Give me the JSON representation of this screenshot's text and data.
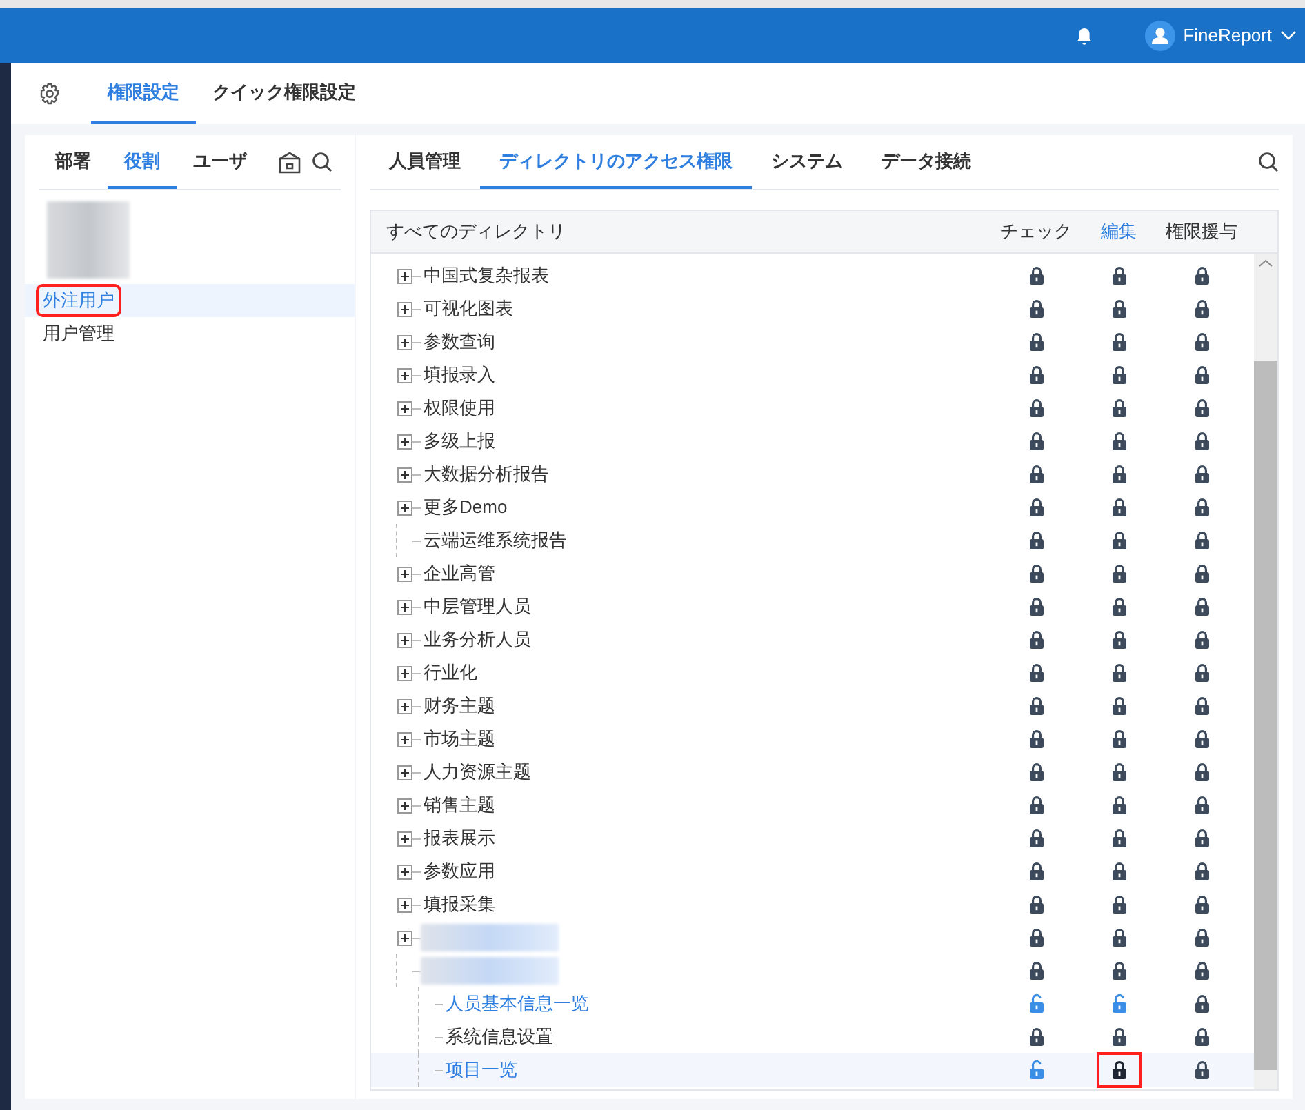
{
  "header": {
    "user": "FineReport"
  },
  "top_tabs": [
    {
      "label": "権限設定",
      "selected": true
    },
    {
      "label": "クイック権限設定",
      "selected": false
    }
  ],
  "left_tabs": [
    {
      "label": "部署",
      "selected": false
    },
    {
      "label": "役割",
      "selected": true
    },
    {
      "label": "ユーザ",
      "selected": false
    }
  ],
  "roles": [
    {
      "kind": "redacted"
    },
    {
      "kind": "item",
      "label": "外注用户",
      "selected": true,
      "highlighted": true
    },
    {
      "kind": "item",
      "label": "用户管理",
      "selected": false,
      "highlighted": false
    }
  ],
  "right_tabs": [
    {
      "label": "人員管理",
      "selected": false
    },
    {
      "label": "ディレクトリのアクセス権限",
      "selected": true
    },
    {
      "label": "システム",
      "selected": false
    },
    {
      "label": "データ接続",
      "selected": false
    }
  ],
  "table": {
    "columns": [
      {
        "label": "すべてのディレクトリ",
        "selected": false
      },
      {
        "label": "チェック",
        "selected": false
      },
      {
        "label": "編集",
        "selected": true
      },
      {
        "label": "権限援与",
        "selected": false
      }
    ],
    "rows": [
      {
        "kind": "item",
        "label": "中国式复杂报表",
        "expandable": true,
        "check_open": false,
        "edit_open": false,
        "grant_open": false
      },
      {
        "kind": "item",
        "label": "可视化图表",
        "expandable": true,
        "check_open": false,
        "edit_open": false,
        "grant_open": false
      },
      {
        "kind": "item",
        "label": "参数查询",
        "expandable": true,
        "check_open": false,
        "edit_open": false,
        "grant_open": false
      },
      {
        "kind": "item",
        "label": "填报录入",
        "expandable": true,
        "check_open": false,
        "edit_open": false,
        "grant_open": false
      },
      {
        "kind": "item",
        "label": "权限使用",
        "expandable": true,
        "check_open": false,
        "edit_open": false,
        "grant_open": false
      },
      {
        "kind": "item",
        "label": "多级上报",
        "expandable": true,
        "check_open": false,
        "edit_open": false,
        "grant_open": false
      },
      {
        "kind": "item",
        "label": "大数据分析报告",
        "expandable": true,
        "check_open": false,
        "edit_open": false,
        "grant_open": false
      },
      {
        "kind": "item",
        "label": "更多Demo",
        "expandable": true,
        "check_open": false,
        "edit_open": false,
        "grant_open": false
      },
      {
        "kind": "item",
        "label": "云端运维系统报告",
        "expandable": false,
        "check_open": false,
        "edit_open": false,
        "grant_open": false
      },
      {
        "kind": "item",
        "label": "企业高管",
        "expandable": true,
        "check_open": false,
        "edit_open": false,
        "grant_open": false
      },
      {
        "kind": "item",
        "label": "中层管理人员",
        "expandable": true,
        "check_open": false,
        "edit_open": false,
        "grant_open": false
      },
      {
        "kind": "item",
        "label": "业务分析人员",
        "expandable": true,
        "check_open": false,
        "edit_open": false,
        "grant_open": false
      },
      {
        "kind": "item",
        "label": "行业化",
        "expandable": true,
        "check_open": false,
        "edit_open": false,
        "grant_open": false
      },
      {
        "kind": "item",
        "label": "财务主题",
        "expandable": true,
        "check_open": false,
        "edit_open": false,
        "grant_open": false
      },
      {
        "kind": "item",
        "label": "市场主题",
        "expandable": true,
        "check_open": false,
        "edit_open": false,
        "grant_open": false
      },
      {
        "kind": "item",
        "label": "人力资源主题",
        "expandable": true,
        "check_open": false,
        "edit_open": false,
        "grant_open": false
      },
      {
        "kind": "item",
        "label": "销售主题",
        "expandable": true,
        "check_open": false,
        "edit_open": false,
        "grant_open": false
      },
      {
        "kind": "item",
        "label": "报表展示",
        "expandable": true,
        "check_open": false,
        "edit_open": false,
        "grant_open": false
      },
      {
        "kind": "item",
        "label": "参数应用",
        "expandable": true,
        "check_open": false,
        "edit_open": false,
        "grant_open": false
      },
      {
        "kind": "item",
        "label": "填报采集",
        "expandable": true,
        "check_open": false,
        "edit_open": false,
        "grant_open": false
      },
      {
        "kind": "redacted",
        "expandable": true,
        "check_open": false,
        "edit_open": false,
        "grant_open": false
      },
      {
        "kind": "redacted",
        "expandable": false,
        "check_open": false,
        "edit_open": false,
        "grant_open": false,
        "children": [
          {
            "kind": "item",
            "label": "人员基本信息一览",
            "selected": false,
            "accent": true,
            "check_open": true,
            "edit_open": true,
            "grant_open": false
          },
          {
            "kind": "item",
            "label": "系统信息设置",
            "selected": false,
            "accent": false,
            "check_open": false,
            "edit_open": false,
            "grant_open": false
          },
          {
            "kind": "item",
            "label": "项目一览",
            "selected": true,
            "accent": true,
            "check_open": true,
            "edit_open": false,
            "edit_highlighted": true,
            "grant_open": false
          }
        ]
      }
    ]
  }
}
